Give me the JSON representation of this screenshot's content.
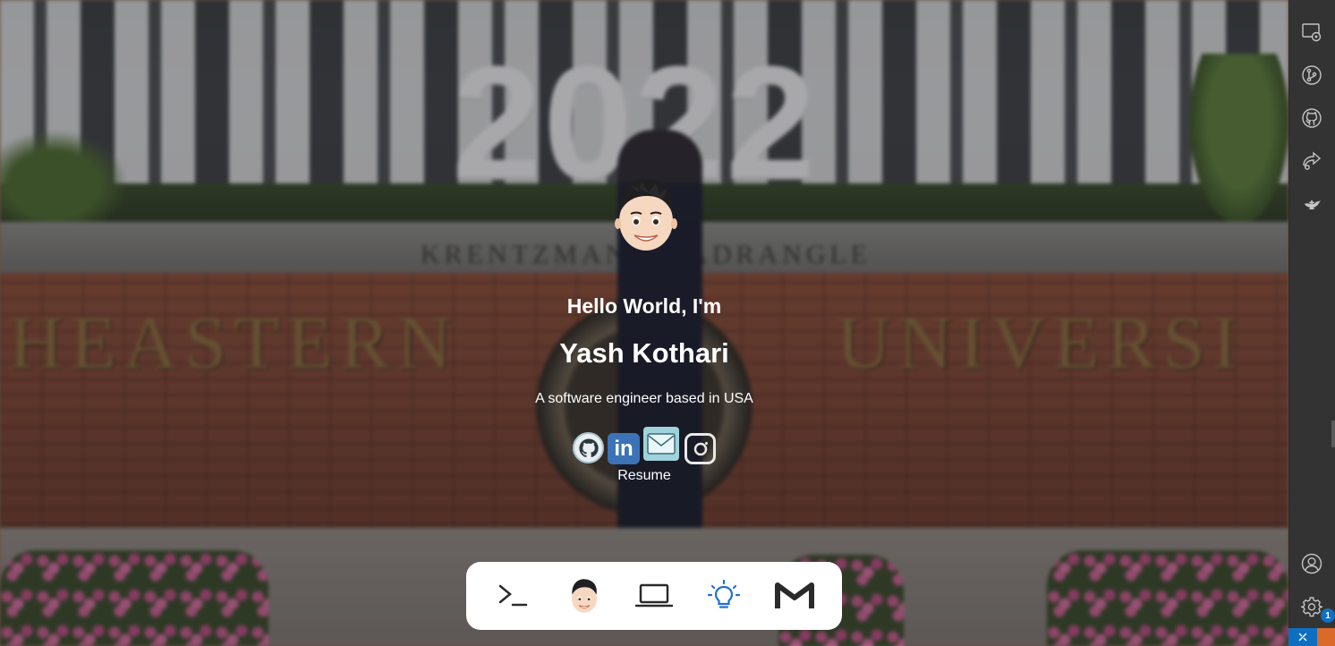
{
  "hero": {
    "background_year": "2022",
    "background_ledge_text": "KRENTZMAN QUADRANGLE",
    "background_wall_left": "HEASTERN",
    "background_wall_right": "UNIVERSI",
    "greeting": "Hello World, I'm",
    "name": "Yash Kothari",
    "tagline": "A software engineer based in USA",
    "resume_label": "Resume",
    "avatar_icon": "memoji-avatar-icon"
  },
  "socials": [
    {
      "name": "github",
      "icon": "github-icon"
    },
    {
      "name": "linkedin",
      "icon": "linkedin-icon",
      "text": "in"
    },
    {
      "name": "email",
      "icon": "mail-icon"
    },
    {
      "name": "instagram",
      "icon": "instagram-icon"
    }
  ],
  "dock": {
    "items": [
      {
        "icon": "terminal-icon"
      },
      {
        "icon": "memoji-avatar-icon"
      },
      {
        "icon": "laptop-icon"
      },
      {
        "icon": "lightbulb-icon"
      },
      {
        "icon": "gmail-icon"
      }
    ]
  },
  "activity_bar": {
    "top_icons": [
      "remote-explorer-icon",
      "source-control-icon",
      "github-icon",
      "live-share-icon",
      "genie-lamp-icon"
    ],
    "bottom_icons": [
      "account-icon",
      "settings-gear-icon"
    ],
    "settings_badge": "1"
  },
  "colors": {
    "activity_bar_bg": "#333333",
    "remote_status": "#0e6fc0",
    "dock_bg": "#ffffff",
    "lightbulb_accent": "#1f6fd1"
  }
}
